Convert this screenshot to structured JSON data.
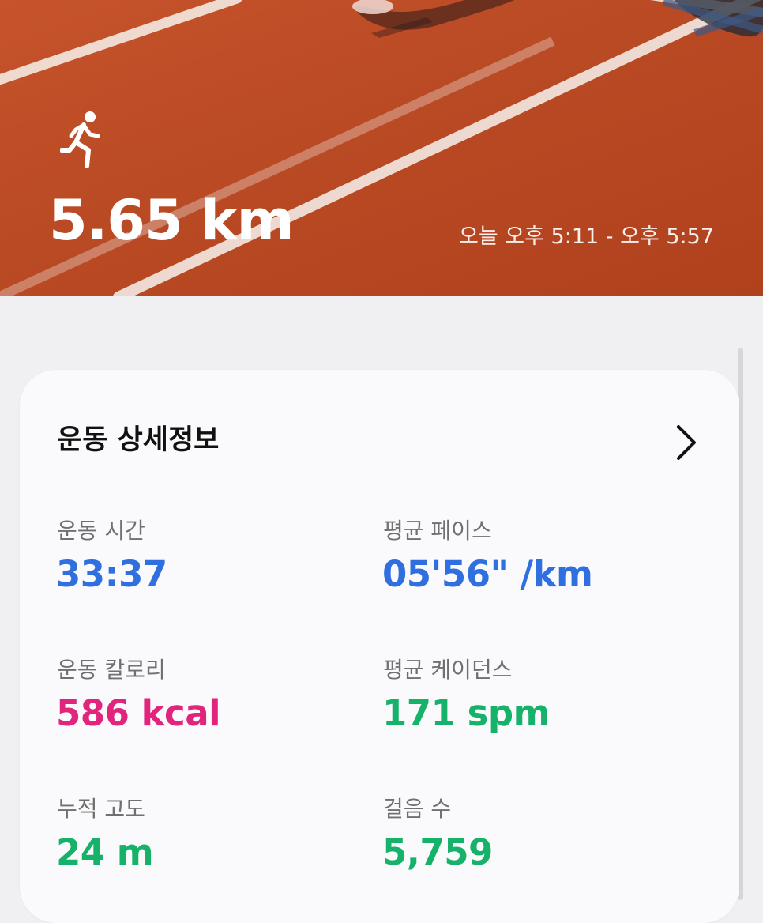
{
  "summary": {
    "distance": "5.65 km",
    "time_range": "오늘 오후 5:11 - 오후 5:57",
    "activity_icon": "running-person-icon"
  },
  "details": {
    "title": "운동 상세정보",
    "chevron_icon": "chevron-right-icon",
    "stats": [
      {
        "label": "운동 시간",
        "value": "33:37",
        "color": "#2f6fe0"
      },
      {
        "label": "평균 페이스",
        "value": "05'56\" /km",
        "color": "#2f6fe0"
      },
      {
        "label": "운동 칼로리",
        "value": "586 kcal",
        "color": "#e1247c"
      },
      {
        "label": "평균 케이던스",
        "value": "171 spm",
        "color": "#17b26a"
      },
      {
        "label": "누적 고도",
        "value": "24 m",
        "color": "#17b26a"
      },
      {
        "label": "걸음 수",
        "value": "5,759",
        "color": "#17b26a"
      }
    ]
  },
  "colors": {
    "track": "#bf4d26",
    "lane_line": "#f3e6df",
    "card_bg": "#fafafc",
    "page_bg": "#f0f0f2"
  }
}
